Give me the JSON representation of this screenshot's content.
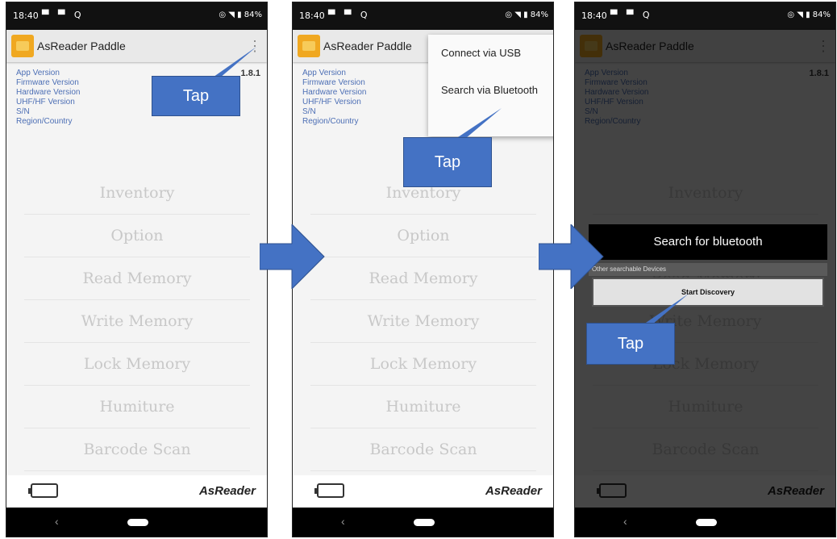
{
  "status_bar": {
    "time": "18:40",
    "icons_left": "▀ ▀ Q",
    "icons_right": "◎ ◥ ▮ 84%"
  },
  "app": {
    "title": "AsReader Paddle",
    "overflow_icon": "⋮"
  },
  "info_labels": [
    "App Version",
    "Firmware Version",
    "Hardware Version",
    "UHF/HF Version",
    "S/N",
    "Region/Country"
  ],
  "app_version_value": "1.8.1",
  "menu_items": [
    "Inventory",
    "Option",
    "Read Memory",
    "Write Memory",
    "Lock Memory",
    "Humiture",
    "Barcode Scan"
  ],
  "brand": "AsReader",
  "dropdown": {
    "items": [
      "Connect via USB",
      "Search via Bluetooth"
    ]
  },
  "dialog": {
    "title": "Search for bluetooth",
    "subtitle": "Other searchable Devices",
    "button": "Start Discovery"
  },
  "callouts": {
    "tap1": "Tap",
    "tap2": "Tap",
    "tap3": "Tap"
  },
  "colors": {
    "callout": "#4472c4",
    "info_text": "#4d6fb5",
    "logo": "#f0a821"
  }
}
